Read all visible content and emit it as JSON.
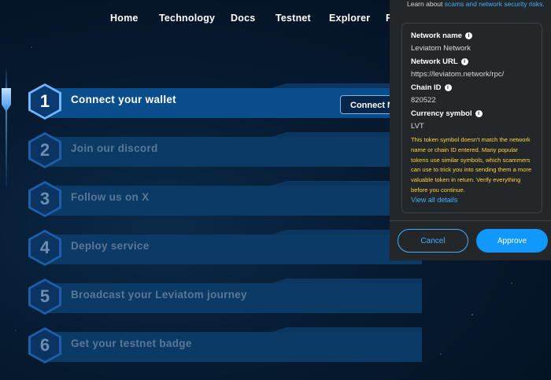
{
  "nav": {
    "items": [
      "Home",
      "Technology",
      "Docs",
      "Testnet",
      "Explorer"
    ],
    "partial": "F"
  },
  "steps": [
    {
      "number": "1",
      "label": "Connect your wallet",
      "active": true
    },
    {
      "number": "2",
      "label": "Join our discord",
      "active": false
    },
    {
      "number": "3",
      "label": "Follow us on X",
      "active": false
    },
    {
      "number": "4",
      "label": "Deploy service",
      "active": false
    },
    {
      "number": "5",
      "label": "Broadcast your Leviatom journey",
      "active": false
    },
    {
      "number": "6",
      "label": "Get your testnet badge",
      "active": false
    }
  ],
  "connect_button": "Connect N",
  "wallet": {
    "learn_prefix": "Learn about ",
    "learn_link": "scams and network security risks.",
    "network_name_label": "Network name",
    "network_name": "Leviatom Network",
    "network_url_label": "Network URL",
    "network_url": "https://leviatom.network/rpc/",
    "chain_id_label": "Chain ID",
    "chain_id": "820522",
    "currency_label": "Currency symbol",
    "currency": "LVT",
    "warning": "This token symbol doesn't match the network name or chain ID entered. Many popular tokens use similar symbols, which scammers can use to trick you into sending them a more valuable token in return. Verify everything before you continue.",
    "view_all": "View all details",
    "cancel": "Cancel",
    "approve": "Approve"
  },
  "colors": {
    "accent": "#1098fc",
    "warning": "#ffd33d",
    "active_band": "#0a4d8c"
  }
}
